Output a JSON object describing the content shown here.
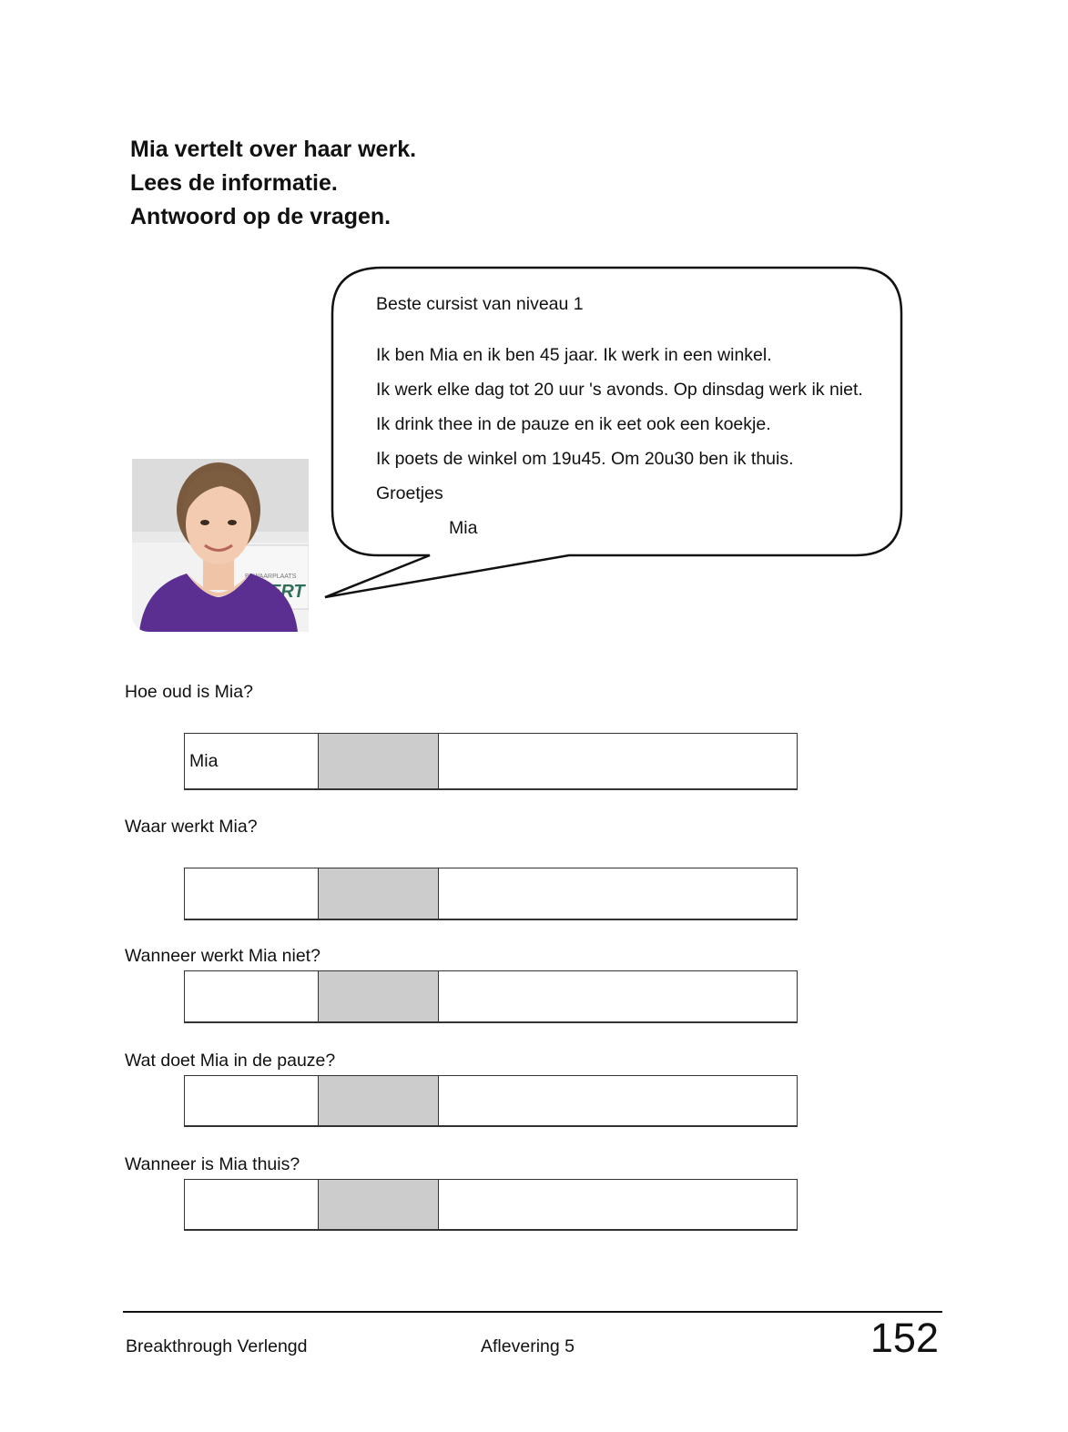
{
  "instructions": [
    "Mia vertelt over haar werk.",
    "Lees de informatie.",
    "Antwoord op de vragen."
  ],
  "bubble": {
    "greeting": "Beste cursist van niveau 1",
    "lines": [
      "Ik ben Mia en ik ben 45 jaar. Ik werk in een winkel.",
      "Ik werk elke dag tot 20 uur 's avonds. Op dinsdag werk ik niet.",
      "Ik drink thee in de pauze en ik eet ook een koekje.",
      "Ik poets de winkel om 19u45. Om 20u30 ben ik thuis.",
      "Groetjes"
    ],
    "signature": "Mia"
  },
  "photo": {
    "box_text": "BEWAARPLAATS",
    "box_logo": "ERT"
  },
  "questions": [
    {
      "question": "Hoe oud is Mia?",
      "answer_prefill": "Mia"
    },
    {
      "question": "Waar werkt Mia?",
      "answer_prefill": ""
    },
    {
      "question": "Wanneer werkt Mia niet?",
      "answer_prefill": ""
    },
    {
      "question": "Wat doet Mia in de pauze?",
      "answer_prefill": ""
    },
    {
      "question": "Wanneer is Mia thuis?",
      "answer_prefill": ""
    }
  ],
  "footer": {
    "left": "Breakthrough Verlengd",
    "middle": "Aflevering 5",
    "page_number": "152"
  },
  "colors": {
    "gray_cell": "#cccccc",
    "shirt": "#5b2f92"
  }
}
